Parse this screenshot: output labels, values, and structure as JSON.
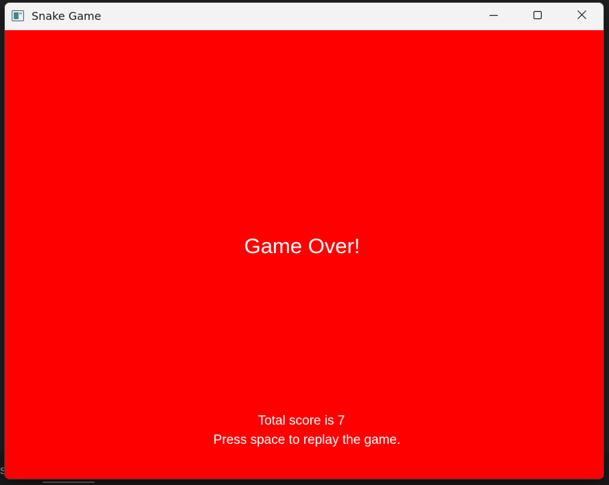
{
  "window": {
    "title": "Snake Game",
    "app_icon": "window-app-icon",
    "controls": {
      "minimize_icon": "minimize-icon",
      "maximize_icon": "maximize-icon",
      "close_icon": "close-icon"
    }
  },
  "game": {
    "headline": "Game Over!",
    "score_text": "Total score is 7",
    "score": 7,
    "instruction": "Press space to replay the game.",
    "background_color": "#ff0000",
    "text_color": "#ffffff"
  },
  "background": {
    "partial_text": "S"
  }
}
